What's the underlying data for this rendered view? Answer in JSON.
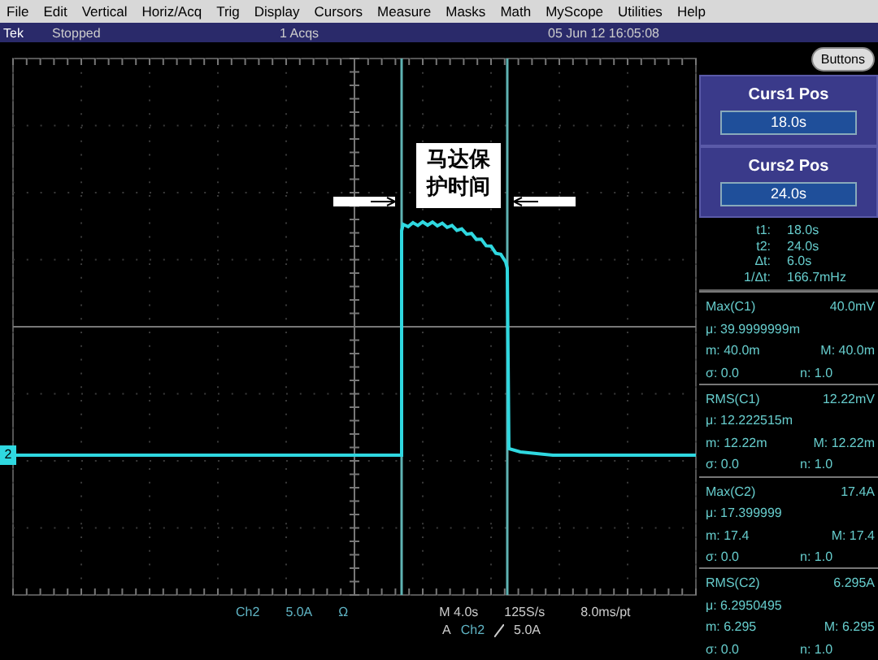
{
  "menu": [
    "File",
    "Edit",
    "Vertical",
    "Horiz/Acq",
    "Trig",
    "Display",
    "Cursors",
    "Measure",
    "Masks",
    "Math",
    "MyScope",
    "Utilities",
    "Help"
  ],
  "status": {
    "brand": "Tek",
    "state": "Stopped",
    "acqs": "1 Acqs",
    "datetime": "05 Jun 12 16:05:08"
  },
  "buttons_button": "Buttons",
  "cursor_controls": [
    {
      "label": "Curs1 Pos",
      "value": "18.0s"
    },
    {
      "label": "Curs2 Pos",
      "value": "24.0s"
    }
  ],
  "cursor_readout": [
    {
      "label": "t1:",
      "value": "18.0s"
    },
    {
      "label": "t2:",
      "value": "24.0s"
    },
    {
      "label": "Δt:",
      "value": "6.0s"
    },
    {
      "label": "1/Δt:",
      "value": "166.7mHz"
    }
  ],
  "measurements": [
    {
      "title": "Max(C1)",
      "reading": "40.0mV",
      "mean": "μ: 39.9999999m",
      "min": "m: 40.0m",
      "max": "M: 40.0m",
      "sigma": "σ: 0.0",
      "n": "n: 1.0"
    },
    {
      "title": "RMS(C1)",
      "reading": "12.22mV",
      "mean": "μ: 12.222515m",
      "min": "m: 12.22m",
      "max": "M: 12.22m",
      "sigma": "σ: 0.0",
      "n": "n: 1.0"
    },
    {
      "title": "Max(C2)",
      "reading": "17.4A",
      "mean": "μ: 17.399999",
      "min": "m: 17.4",
      "max": "M: 17.4",
      "sigma": "σ: 0.0",
      "n": "n: 1.0"
    },
    {
      "title": "RMS(C2)",
      "reading": "6.295A",
      "mean": "μ: 6.2950495",
      "min": "m: 6.295",
      "max": "M: 6.295",
      "sigma": "σ: 0.0",
      "n": "n: 1.0"
    }
  ],
  "annotation": "马达保护时间",
  "channel_marker": "2",
  "readout": {
    "channel": "Ch2",
    "scale": "5.0A",
    "coupling": "Ω",
    "timebase": "M 4.0s",
    "rate": "125S/s",
    "record": "8.0ms/pt",
    "trigger_mode": "A",
    "trigger_source": "Ch2",
    "trigger_level": "5.0A"
  }
}
